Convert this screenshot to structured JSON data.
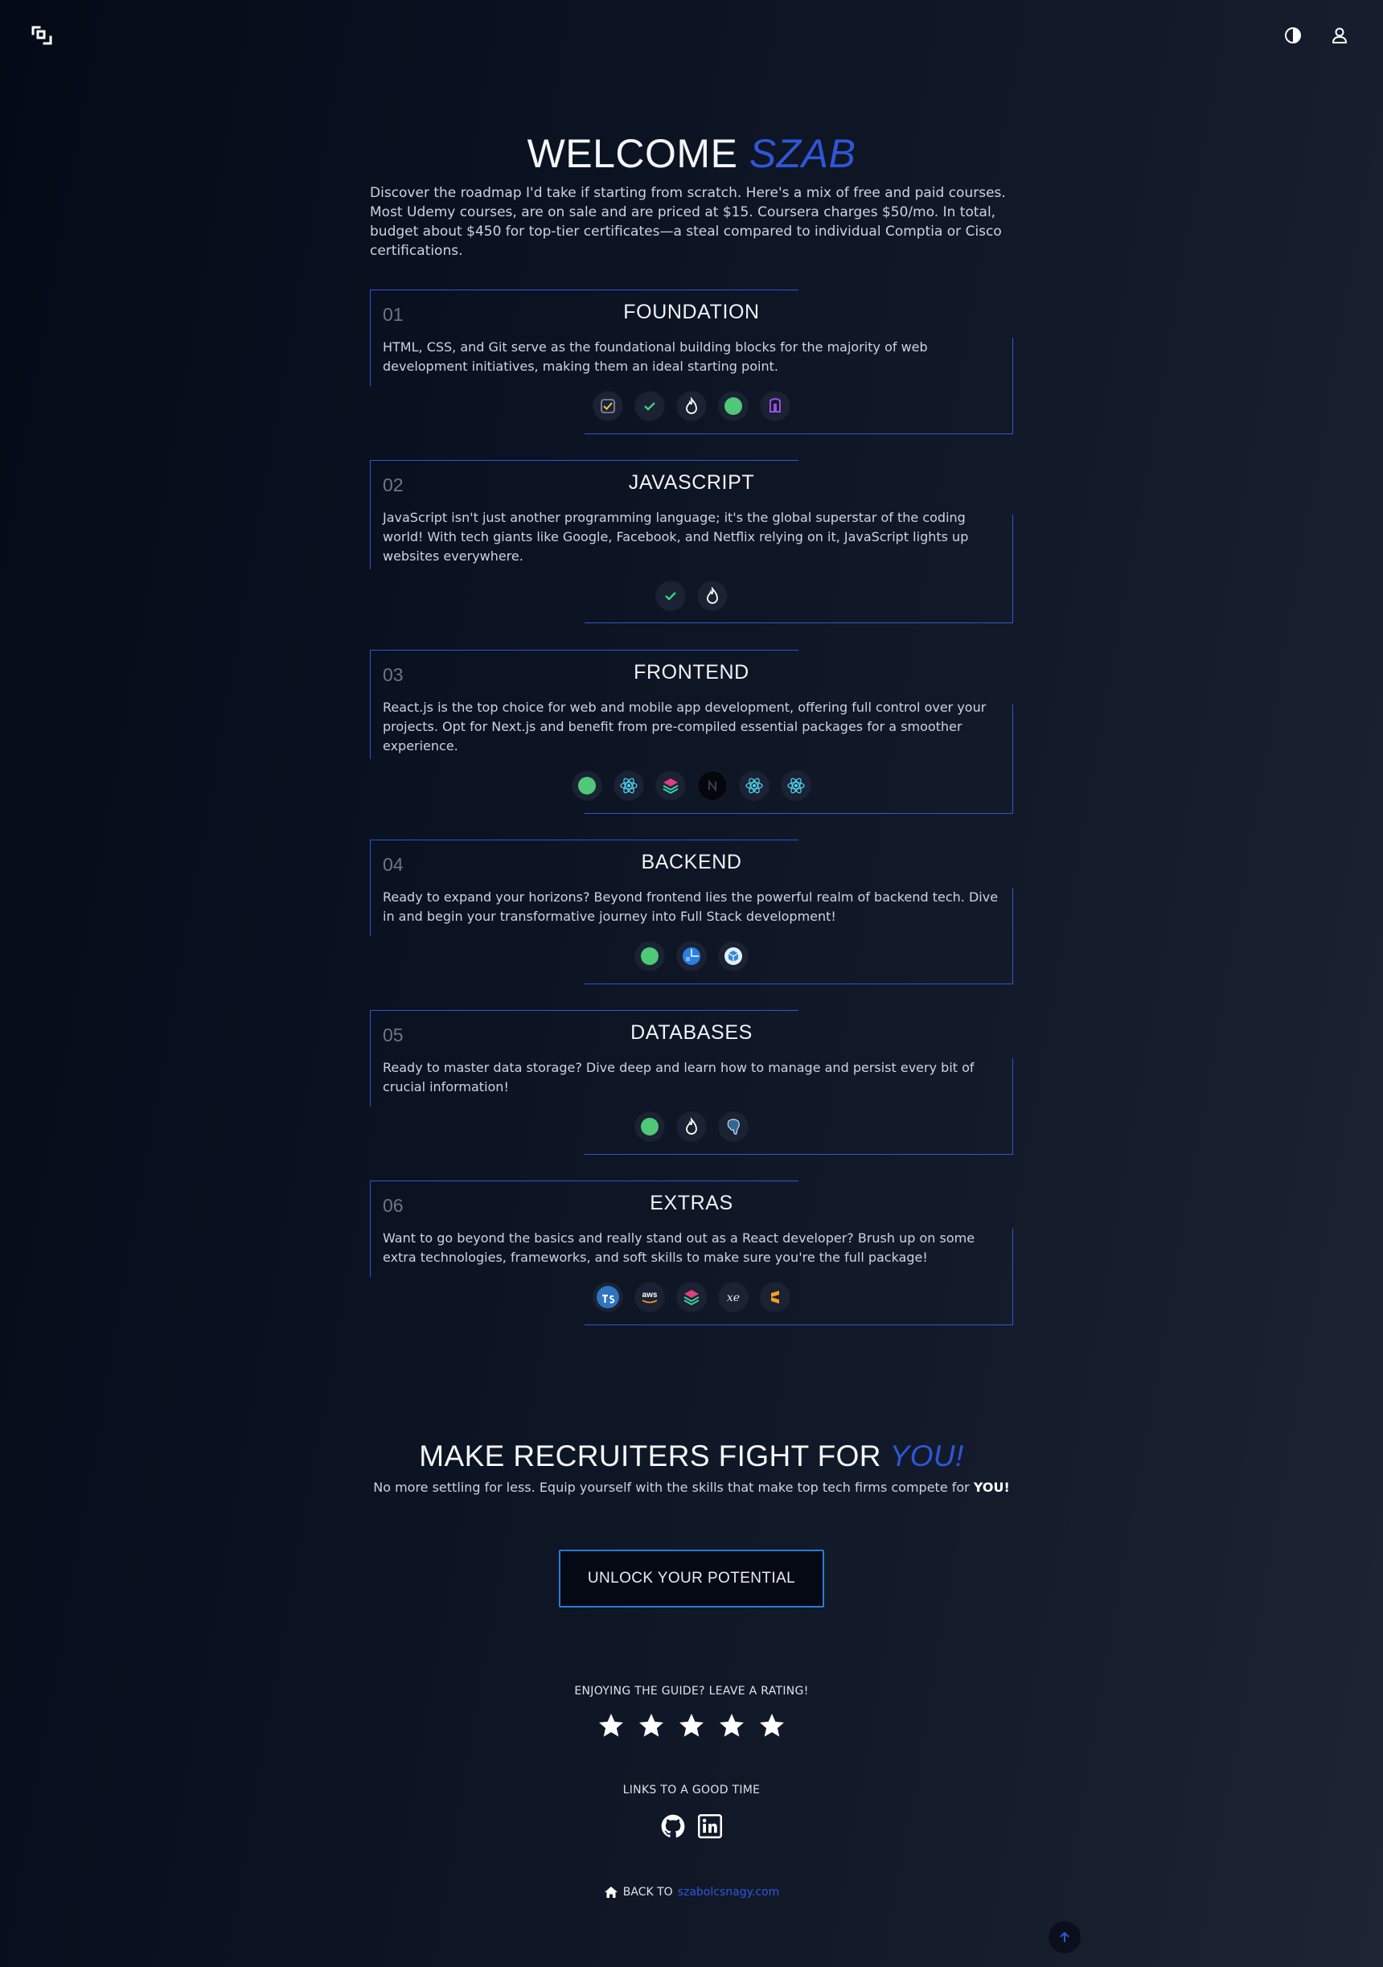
{
  "hero": {
    "title_prefix": "WELCOME",
    "title_name": "SZAB",
    "intro": "Discover the roadmap I'd take if starting from scratch. Here's a mix of free and paid courses. Most Udemy courses, are on sale and are priced at $15. Coursera charges $50/mo. In total, budget about $450 for top-tier certificates—a steal compared to individual Comptia or Cisco certifications."
  },
  "sections": [
    {
      "num": "01",
      "title": "FOUNDATION",
      "desc": "HTML, CSS, and Git serve as the foundational building blocks for the majority of web development initiatives, making them an ideal starting point.",
      "icons": [
        "checklist-icon",
        "check-icon",
        "flame-icon",
        "green-circle-icon",
        "purple-shield-icon"
      ]
    },
    {
      "num": "02",
      "title": "JAVASCRIPT",
      "desc": "JavaScript isn't just another programming language; it's the global superstar of the coding world! With tech giants like Google, Facebook, and Netflix relying on it, JavaScript lights up websites everywhere.",
      "icons": [
        "check-icon",
        "flame-icon"
      ]
    },
    {
      "num": "03",
      "title": "FRONTEND",
      "desc": "React.js is the top choice for web and mobile app development, offering full control over your projects. Opt for Next.js and benefit from pre-compiled essential packages for a smoother experience.",
      "icons": [
        "green-circle-icon",
        "react-icon",
        "layers-icon",
        "nextjs-icon",
        "react-icon",
        "react-icon"
      ]
    },
    {
      "num": "04",
      "title": "BACKEND",
      "desc": "Ready to expand your horizons? Beyond frontend lies the powerful realm of backend tech. Dive in and begin your transformative journey into Full Stack development!",
      "icons": [
        "green-circle-icon",
        "blue-grid-icon",
        "cube-icon"
      ]
    },
    {
      "num": "05",
      "title": "DATABASES",
      "desc": "Ready to master data storage? Dive deep and learn how to manage and persist every bit of crucial information!",
      "icons": [
        "green-circle-icon",
        "flame-icon",
        "elephant-icon"
      ]
    },
    {
      "num": "06",
      "title": "EXTRAS",
      "desc": "Want to go beyond the basics and really stand out as a React developer? Brush up on some extra technologies, frameworks, and soft skills to make sure you're the full package!",
      "icons": [
        "typescript-icon",
        "aws-icon",
        "layers-icon",
        "xe-icon",
        "sublime-icon"
      ]
    }
  ],
  "cta": {
    "title_prefix": "MAKE RECRUITERS FIGHT FOR",
    "title_accent": "YOU!",
    "subtitle": "No more settling for less. Equip yourself with the skills that make top tech firms compete for",
    "subtitle_bold": "YOU!",
    "button": "UNLOCK YOUR POTENTIAL"
  },
  "rating": {
    "label": "ENJOYING THE GUIDE? LEAVE A RATING!",
    "stars": 5
  },
  "links": {
    "label": "LINKS TO A GOOD TIME",
    "items": [
      "github-icon",
      "linkedin-icon"
    ]
  },
  "footer": {
    "back_text": "BACK TO",
    "back_link": "szabolcsnagy.com"
  },
  "colors": {
    "accent": "#2f56d6",
    "border": "#2f56d6",
    "button_border": "#2a7ad8"
  }
}
